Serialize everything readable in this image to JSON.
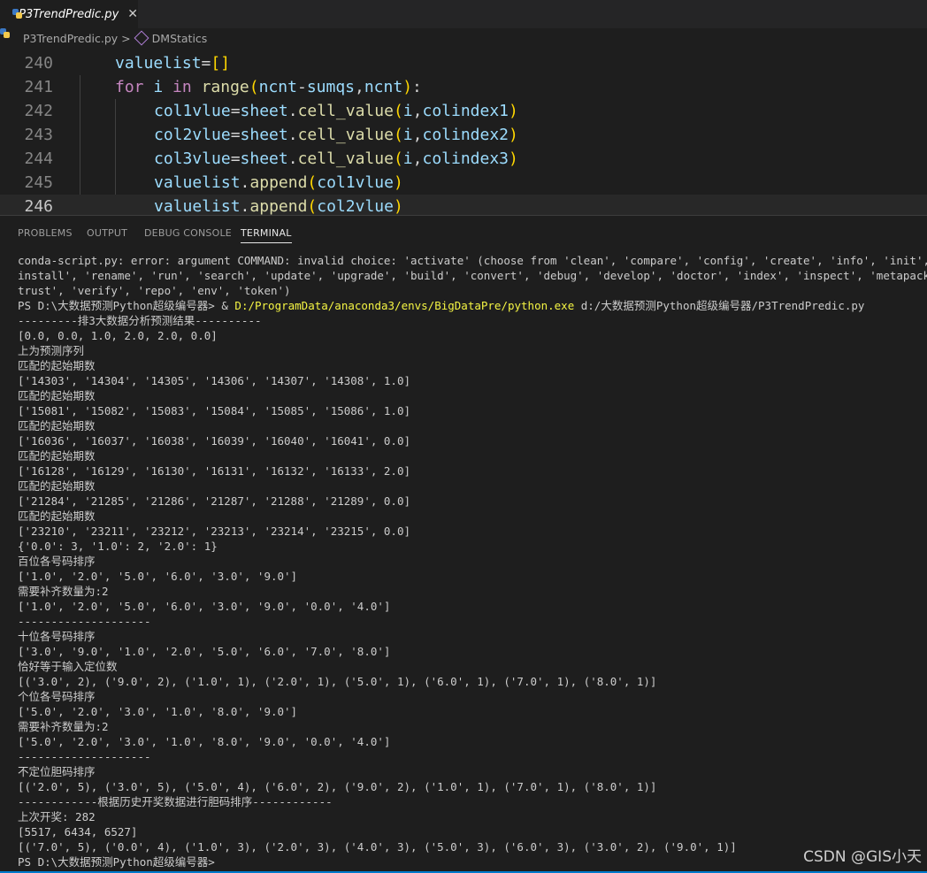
{
  "tab": {
    "filename": "P3TrendPredic.py",
    "close_glyph": "✕"
  },
  "breadcrumb": {
    "file": "P3TrendPredic.py",
    "separator": ">",
    "symbol": "DMStatics"
  },
  "editor": {
    "lines": [
      {
        "number": "240",
        "code": "valuelist=[]"
      },
      {
        "number": "241",
        "code": "for i in range(ncnt-sumqs,ncnt):"
      },
      {
        "number": "242",
        "code": "col1vlue=sheet.cell_value(i,colindex1)"
      },
      {
        "number": "243",
        "code": "col2vlue=sheet.cell_value(i,colindex2)"
      },
      {
        "number": "244",
        "code": "col3vlue=sheet.cell_value(i,colindex3)"
      },
      {
        "number": "245",
        "code": "valuelist.append(col1vlue)"
      },
      {
        "number": "246",
        "code": "valuelist.append(col2vlue)"
      }
    ]
  },
  "panel": {
    "tabs": [
      "PROBLEMS",
      "OUTPUT",
      "DEBUG CONSOLE",
      "TERMINAL"
    ],
    "active": "TERMINAL"
  },
  "terminal": {
    "prompt_prefix": "PS D:\\大数据预测Python超级编号器> & ",
    "python_path": "D:/ProgramData/anaconda3/envs/BigDataPre/python.exe",
    "script_arg": " d:/大数据预测Python超级编号器/P3TrendPredic.py",
    "lines_before": [
      "conda-script.py: error: argument COMMAND: invalid choice: 'activate' (choose from 'clean', 'compare', 'config', 'create', 'info', 'init', 'install', 'list',",
      "install', 'rename', 'run', 'search', 'update', 'upgrade', 'build', 'convert', 'debug', 'develop', 'doctor', 'index', 'inspect', 'metapackage', 'render', 'skeleton',",
      "trust', 'verify', 'repo', 'env', 'token')"
    ],
    "lines_after": [
      "---------排3大数据分析预测结果----------",
      "[0.0, 0.0, 1.0, 2.0, 2.0, 0.0]",
      "上为预测序列",
      "匹配的起始期数",
      "['14303', '14304', '14305', '14306', '14307', '14308', 1.0]",
      "匹配的起始期数",
      "['15081', '15082', '15083', '15084', '15085', '15086', 1.0]",
      "匹配的起始期数",
      "['16036', '16037', '16038', '16039', '16040', '16041', 0.0]",
      "匹配的起始期数",
      "['16128', '16129', '16130', '16131', '16132', '16133', 2.0]",
      "匹配的起始期数",
      "['21284', '21285', '21286', '21287', '21288', '21289', 0.0]",
      "匹配的起始期数",
      "['23210', '23211', '23212', '23213', '23214', '23215', 0.0]",
      "{'0.0': 3, '1.0': 2, '2.0': 1}",
      "百位各号码排序",
      "['1.0', '2.0', '5.0', '6.0', '3.0', '9.0']",
      "需要补齐数量为:2",
      "['1.0', '2.0', '5.0', '6.0', '3.0', '9.0', '0.0', '4.0']",
      "--------------------",
      "十位各号码排序",
      "['3.0', '9.0', '1.0', '2.0', '5.0', '6.0', '7.0', '8.0']",
      "恰好等于输入定位数",
      "[('3.0', 2), ('9.0', 2), ('1.0', 1), ('2.0', 1), ('5.0', 1), ('6.0', 1), ('7.0', 1), ('8.0', 1)]",
      "个位各号码排序",
      "['5.0', '2.0', '3.0', '1.0', '8.0', '9.0']",
      "需要补齐数量为:2",
      "['5.0', '2.0', '3.0', '1.0', '8.0', '9.0', '0.0', '4.0']",
      "--------------------",
      "不定位胆码排序",
      "[('2.0', 5), ('3.0', 5), ('5.0', 4), ('6.0', 2), ('9.0', 2), ('1.0', 1), ('7.0', 1), ('8.0', 1)]",
      "------------根据历史开奖数据进行胆码排序------------",
      "上次开奖: 282",
      "[5517, 6434, 6527]",
      "[('7.0', 5), ('0.0', 4), ('1.0', 3), ('2.0', 3), ('4.0', 3), ('5.0', 3), ('6.0', 3), ('3.0', 2), ('9.0', 1)]",
      "PS D:\\大数据预测Python超级编号器>"
    ]
  },
  "watermark": "CSDN @GIS小天"
}
